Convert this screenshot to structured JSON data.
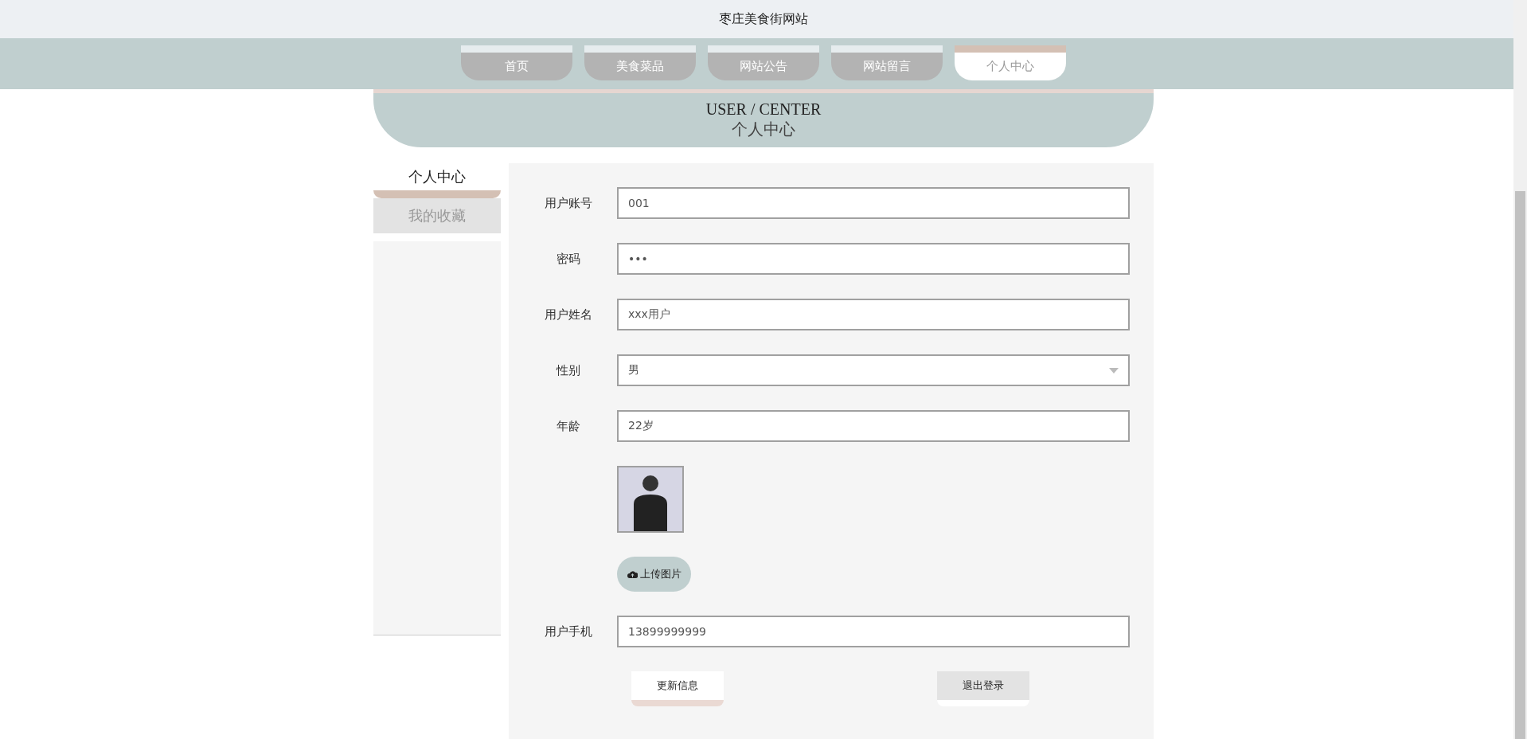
{
  "site_title": "枣庄美食街网站",
  "nav": [
    {
      "label": "首页",
      "selected": false
    },
    {
      "label": "美食菜品",
      "selected": false
    },
    {
      "label": "网站公告",
      "selected": false
    },
    {
      "label": "网站留言",
      "selected": false
    },
    {
      "label": "个人中心",
      "selected": true
    }
  ],
  "banner": {
    "title_en": "USER / CENTER",
    "title_cn": "个人中心"
  },
  "sidebar": {
    "items": [
      {
        "label": "个人中心",
        "selected": true
      },
      {
        "label": "我的收藏",
        "selected": false
      }
    ]
  },
  "form": {
    "fields": [
      {
        "kind": "text",
        "label": "用户账号",
        "value": "001"
      },
      {
        "kind": "text",
        "label": "密码",
        "value": "•••"
      },
      {
        "kind": "text",
        "label": "用户姓名",
        "value": "xxx用户"
      },
      {
        "kind": "select",
        "label": "性别",
        "value": "男"
      },
      {
        "kind": "text",
        "label": "年龄",
        "value": "22岁"
      },
      {
        "kind": "image",
        "upload_label": "上传图片"
      },
      {
        "kind": "text",
        "label": "用户手机",
        "value": "13899999999"
      }
    ],
    "buttons": [
      {
        "label": "更新信息",
        "kind": "primary"
      },
      {
        "label": "退出登录",
        "kind": "secondary"
      }
    ]
  }
}
